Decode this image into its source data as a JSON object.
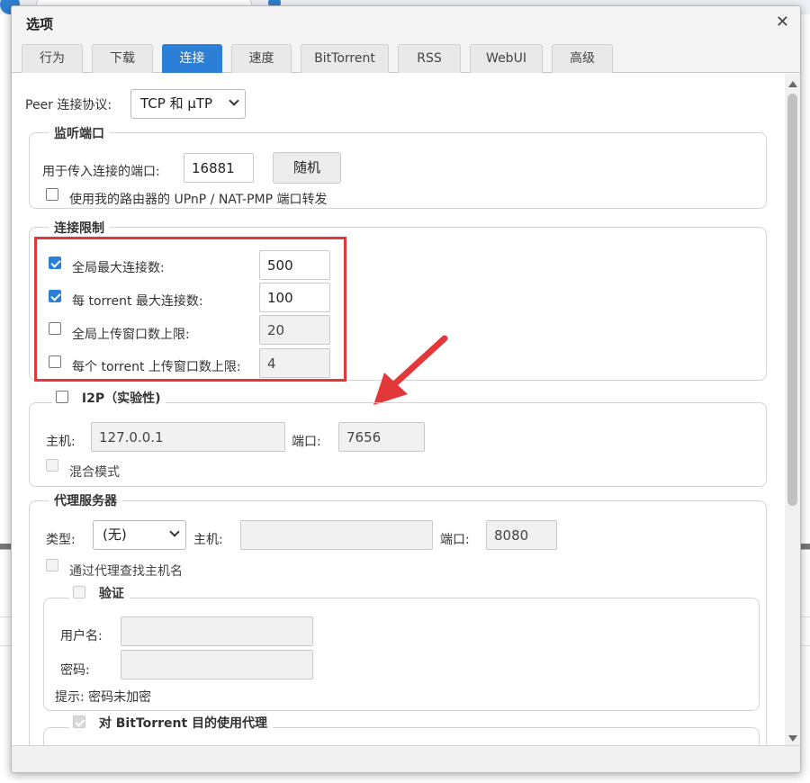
{
  "dialog": {
    "title": "选项",
    "close_icon": "close-icon"
  },
  "tabs": [
    {
      "label": "行为",
      "active": false
    },
    {
      "label": "下载",
      "active": false
    },
    {
      "label": "连接",
      "active": true
    },
    {
      "label": "速度",
      "active": false
    },
    {
      "label": "BitTorrent",
      "active": false
    },
    {
      "label": "RSS",
      "active": false
    },
    {
      "label": "WebUI",
      "active": false
    },
    {
      "label": "高级",
      "active": false
    }
  ],
  "peer_protocol": {
    "label": "Peer 连接协议:",
    "value": "TCP 和 μTP"
  },
  "listening_port": {
    "legend": "监听端口",
    "port_label": "用于传入连接的端口:",
    "port_value": "16881",
    "random_button": "随机",
    "upnp_label": "使用我的路由器的 UPnP / NAT-PMP 端口转发",
    "upnp_checked": false
  },
  "connection_limits": {
    "legend": "连接限制",
    "rows": [
      {
        "label": "全局最大连接数:",
        "value": "500",
        "checked": true
      },
      {
        "label": "每 torrent 最大连接数:",
        "value": "100",
        "checked": true
      },
      {
        "label": "全局上传窗口数上限:",
        "value": "20",
        "checked": false
      },
      {
        "label": "每个 torrent 上传窗口数上限:",
        "value": "4",
        "checked": false
      }
    ]
  },
  "i2p": {
    "legend": "I2P（实验性)",
    "host_label": "主机:",
    "host_value": "127.0.0.1",
    "port_label": "端口:",
    "port_value": "7656",
    "mixed_label": "混合模式"
  },
  "proxy": {
    "legend": "代理服务器",
    "type_label": "类型:",
    "type_value": "(无)",
    "host_label": "主机:",
    "host_value": "",
    "port_label": "端口:",
    "port_value": "8080",
    "lookup_label": "通过代理查找主机名",
    "auth": {
      "legend": "验证",
      "username_label": "用户名:",
      "password_label": "密码:",
      "hint": "提示: 密码未加密"
    },
    "bittorrent_legend": "对 BitTorrent 目的使用代理"
  },
  "annotation": {
    "highlight_color": "#e2383a",
    "accent_color": "#2b7fd6"
  }
}
